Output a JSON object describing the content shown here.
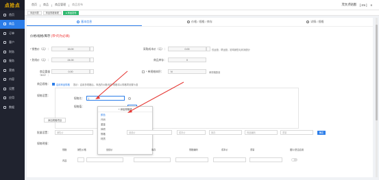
{
  "logo": "点拾点",
  "sidebar": {
    "items": [
      {
        "label": "首页"
      },
      {
        "label": "商品"
      },
      {
        "label": "订单"
      },
      {
        "label": "客户"
      },
      {
        "label": "财务"
      },
      {
        "label": "服务"
      },
      {
        "label": "营销"
      },
      {
        "label": "内容"
      },
      {
        "label": "设置"
      },
      {
        "label": "应用"
      },
      {
        "label": "数据"
      }
    ]
  },
  "header": {
    "breadcrumb": [
      "首页",
      "商品",
      "商品管理",
      "商品发布"
    ],
    "store_name": "茂文点贴图",
    "user": "[ zm ]"
  },
  "tabs": [
    {
      "label": "商品列表"
    },
    {
      "label": "商品规格管理"
    },
    {
      "label": "● 商品发布"
    }
  ],
  "steps": [
    {
      "label": "基本信息"
    },
    {
      "label": "价格 / 规格 / 库存"
    },
    {
      "label": "详情 / 规格"
    }
  ],
  "form": {
    "section_title": "价格/规格/库存",
    "section_required": "(带*的为必填)",
    "retail_price_label": "* 销售价（元）：",
    "retail_price_value": "15.00",
    "cost_price_label": "采购成本价（元）：",
    "cost_price_value": "0.00",
    "cost_price_hint": "仅运营、帮运营，影响销售毛利润统计",
    "market_price_label": "* 划线价（元）：",
    "market_price_value": "24.00",
    "stock_label": "商品库存：",
    "stock_value": "0",
    "weight_label": "商品重量（KG）：",
    "weight_value": "0.00",
    "volume_label": "* 单规格体积：",
    "volume_value": "N",
    "volume_hint": "单规格数量",
    "spec_label": "商品规格：",
    "spec_checkbox_label": "启用商品规格",
    "spec_hint": "提示：启用多规格后，商品的价格/库存/规格将以规格项设置为准",
    "spec_setting_label": "规格设置：",
    "spec_name_label": "规格名：",
    "spec_name_value": "|",
    "spec_value_label": "规格值：",
    "add_spec_value_button": "添加",
    "add_spec_button": "添加规格项目",
    "batch_label": "批量设置：",
    "batch_fields": [
      "销售价",
      "划线价",
      "成本价",
      "库存",
      "商品编码",
      "重量"
    ],
    "batch_confirm": "确定",
    "spec_detail_label": "规格明细：",
    "table_headers": [
      "规格",
      "销售价格",
      "划线价",
      "库存",
      "规格编码",
      "成本价",
      "重量",
      "图片/是否启用"
    ],
    "table_row_label": "内容"
  },
  "dropdown": {
    "add_label": "+ 添加规格项",
    "options": [
      "颜色",
      "尺码",
      "重量",
      "体积",
      "规格",
      "材质"
    ],
    "selected_index": 0
  }
}
